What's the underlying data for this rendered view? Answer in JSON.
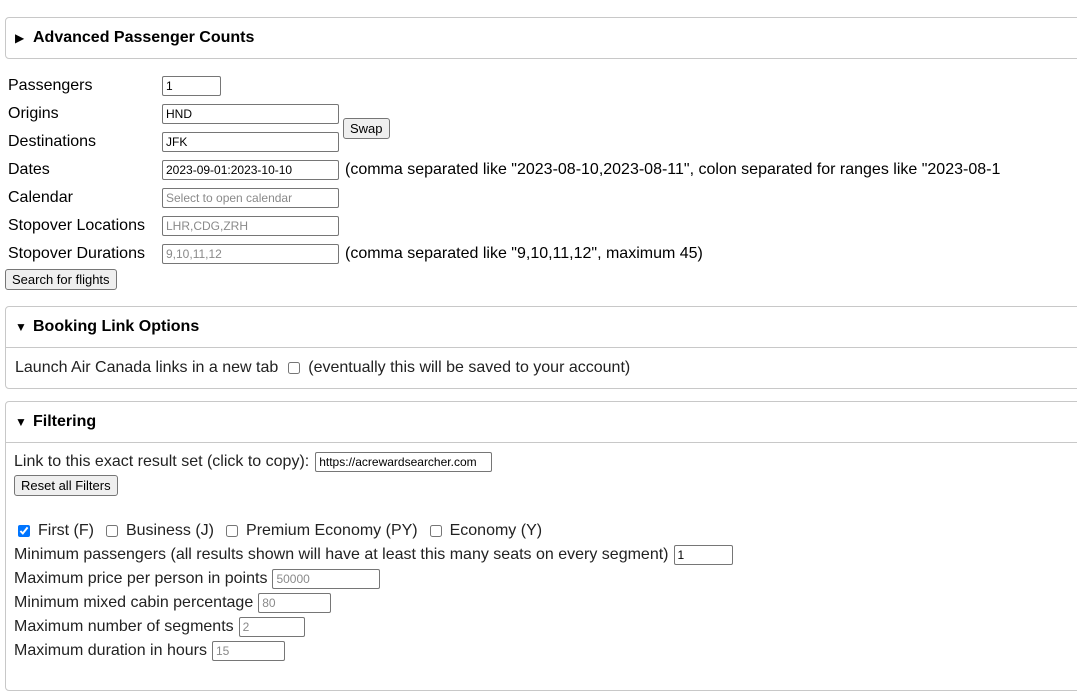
{
  "advanced": {
    "title": "Advanced Passenger Counts",
    "arrow": "▶"
  },
  "search": {
    "passengers_label": "Passengers",
    "passengers_value": "1",
    "origins_label": "Origins",
    "origins_value": "HND",
    "destinations_label": "Destinations",
    "destinations_value": "JFK",
    "swap_label": "Swap",
    "dates_label": "Dates",
    "dates_value": "2023-09-01:2023-10-10",
    "dates_hint": "(comma separated like \"2023-08-10,2023-08-11\", colon separated for ranges like \"2023-08-1",
    "calendar_label": "Calendar",
    "calendar_placeholder": "Select to open calendar",
    "stopover_locations_label": "Stopover Locations",
    "stopover_locations_placeholder": "LHR,CDG,ZRH",
    "stopover_durations_label": "Stopover Durations",
    "stopover_durations_placeholder": "9,10,11,12",
    "stopover_durations_hint": "(comma separated like \"9,10,11,12\", maximum 45)",
    "search_button": "Search for flights"
  },
  "booking": {
    "title": "Booking Link Options",
    "arrow": "▼",
    "launch_label": "Launch Air Canada links in a new tab",
    "launch_checked": false,
    "launch_note": "(eventually this will be saved to your account)"
  },
  "filtering": {
    "title": "Filtering",
    "arrow": "▼",
    "link_label": "Link to this exact result set (click to copy):",
    "link_value": "https://acrewardsearcher.com",
    "reset_button": "Reset all Filters",
    "cabins": [
      {
        "label": "First (F)",
        "checked": true
      },
      {
        "label": "Business (J)",
        "checked": false
      },
      {
        "label": "Premium Economy (PY)",
        "checked": false
      },
      {
        "label": "Economy (Y)",
        "checked": false
      }
    ],
    "min_passengers_label": "Minimum passengers (all results shown will have at least this many seats on every segment)",
    "min_passengers_value": "1",
    "max_price_label": "Maximum price per person in points",
    "max_price_placeholder": "50000",
    "min_mixed_label": "Minimum mixed cabin percentage",
    "min_mixed_placeholder": "80",
    "max_segments_label": "Maximum number of segments",
    "max_segments_placeholder": "2",
    "max_duration_label": "Maximum duration in hours",
    "max_duration_placeholder": "15"
  }
}
